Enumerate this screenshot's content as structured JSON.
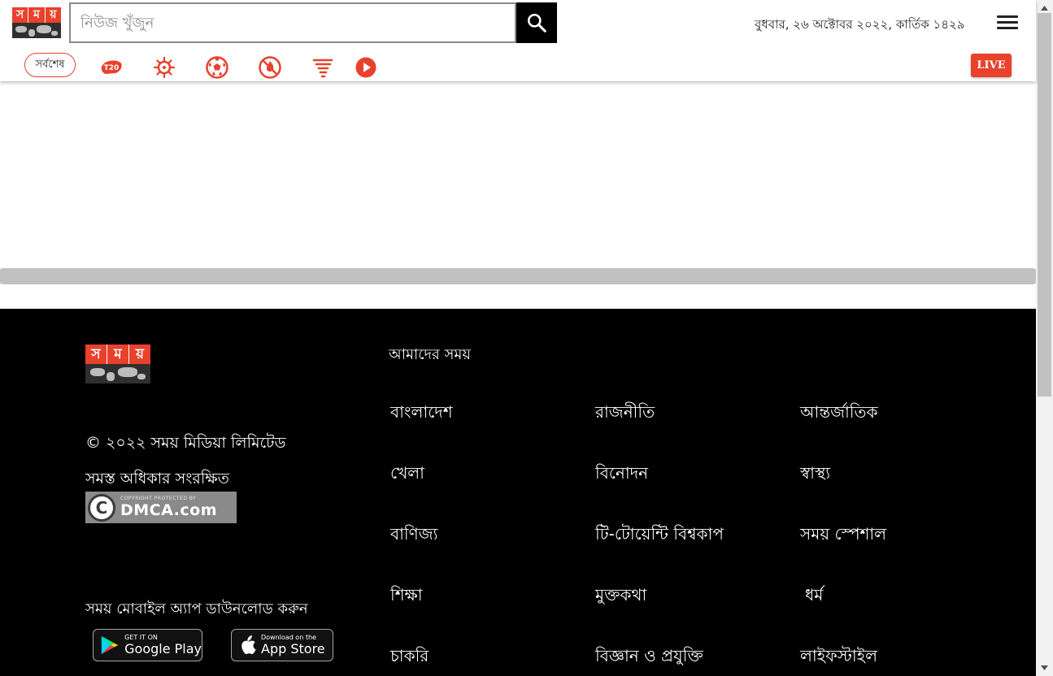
{
  "header": {
    "logo_text": [
      "স",
      "ম",
      "য়"
    ],
    "search_placeholder": "নিউজ খুঁজুন",
    "date": "বুধবার, ২৬ অক্টোবর ২০২২, কার্তিক ১৪২৯"
  },
  "nav": {
    "latest_label": "সর্বশেষ",
    "icons": [
      "t20-icon",
      "virus-icon",
      "football-icon",
      "no-fire-icon",
      "tornado-icon",
      "play-icon"
    ],
    "live_label": "LIVE"
  },
  "footer": {
    "copyright": "© ২০২২ সময় মিডিয়া লিমিটেড",
    "rights": "সমস্ত অধিকার সংরক্ষিত",
    "dmca_top": "COPYRIGHT PROTECTED BY",
    "dmca_main": "DMCA.com",
    "app_download_text": "সময় মোবাইল অ্যাপ ডাউনলোড করুন",
    "google_play_small": "GET IT ON",
    "google_play_big": "Google Play",
    "app_store_small": "Download on the",
    "app_store_big": "App Store",
    "our_somoy_heading": "আমাদের সময়",
    "categories": [
      "বাংলাদেশ",
      "রাজনীতি",
      "আন্তর্জাতিক",
      "খেলা",
      "বিনোদন",
      "স্বাস্থ্য",
      "বাণিজ্য",
      "টি-টোয়েন্টি বিশ্বকাপ",
      "সময় স্পেশাল",
      "শিক্ষা",
      "মুক্তকথা",
      "ধর্ম",
      "চাকরি",
      "বিজ্ঞান ও প্রযুক্তি",
      "লাইফস্টাইল"
    ]
  },
  "colors": {
    "brand_red": "#e8412c",
    "footer_bg": "#000000"
  }
}
